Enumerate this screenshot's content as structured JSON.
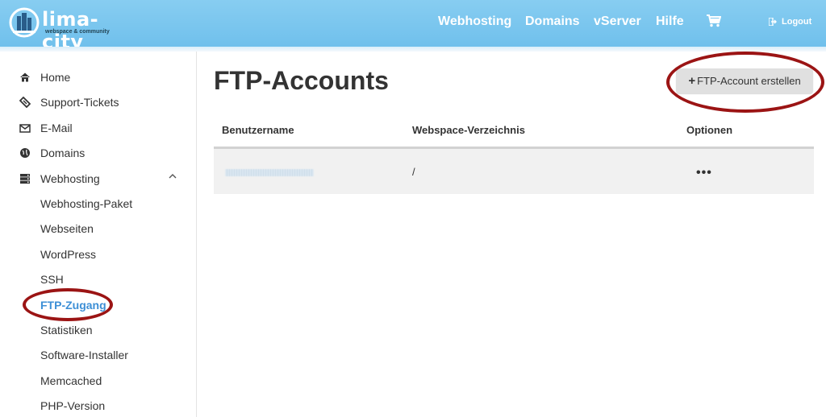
{
  "brand": {
    "name": "lima-city",
    "tagline": "webspace & community"
  },
  "topnav": {
    "items": [
      "Webhosting",
      "Domains",
      "vServer",
      "Hilfe"
    ],
    "cart_icon": "shopping-cart-icon",
    "logout_label": "Logout"
  },
  "sidebar": {
    "items": [
      {
        "label": "Home",
        "icon": "home-icon"
      },
      {
        "label": "Support-Tickets",
        "icon": "ticket-icon"
      },
      {
        "label": "E-Mail",
        "icon": "envelope-icon"
      },
      {
        "label": "Domains",
        "icon": "globe-icon"
      },
      {
        "label": "Webhosting",
        "icon": "server-icon"
      }
    ],
    "subitems": [
      "Webhosting-Paket",
      "Webseiten",
      "WordPress",
      "SSH",
      "FTP-Zugang",
      "Statistiken",
      "Software-Installer",
      "Memcached",
      "PHP-Version"
    ],
    "active_subitem": "FTP-Zugang"
  },
  "main": {
    "title": "FTP-Accounts",
    "create_button": {
      "icon": "+",
      "label": "FTP-Account erstellen"
    },
    "table": {
      "headers": [
        "Benutzername",
        "Webspace-Verzeichnis",
        "Optionen"
      ],
      "rows": [
        {
          "directory": "/",
          "options": "•••"
        }
      ]
    }
  },
  "colors": {
    "topbar": "#78c5ee",
    "active_link": "#3d8fd6",
    "annotation": "#9b1414"
  }
}
